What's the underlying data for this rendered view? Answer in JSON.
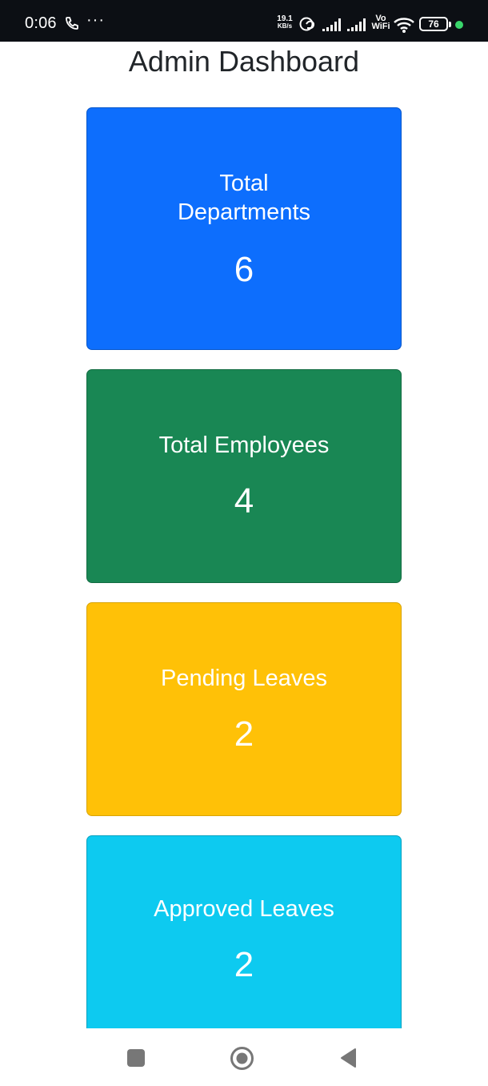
{
  "status_bar": {
    "time": "0:06",
    "net_speed_value": "19.1",
    "net_speed_unit": "KB/s",
    "vowifi_top": "Vo",
    "vowifi_bottom": "WiFi",
    "battery_level": "76",
    "icons": [
      "phone-icon",
      "more-dots-icon",
      "link-icon",
      "signal-icon",
      "signal-icon",
      "wifi-icon",
      "battery-icon"
    ]
  },
  "page": {
    "title": "Admin Dashboard"
  },
  "cards": [
    {
      "label": "Total Departments",
      "value": "6",
      "color": "#0d6efd"
    },
    {
      "label": "Total Employees",
      "value": "4",
      "color": "#198754"
    },
    {
      "label": "Pending Leaves",
      "value": "2",
      "color": "#ffc107"
    },
    {
      "label": "Approved Leaves",
      "value": "2",
      "color": "#0dcaf0"
    }
  ],
  "nav_bar": {
    "buttons": [
      "recents-square-icon",
      "home-circle-icon",
      "back-triangle-icon"
    ]
  }
}
